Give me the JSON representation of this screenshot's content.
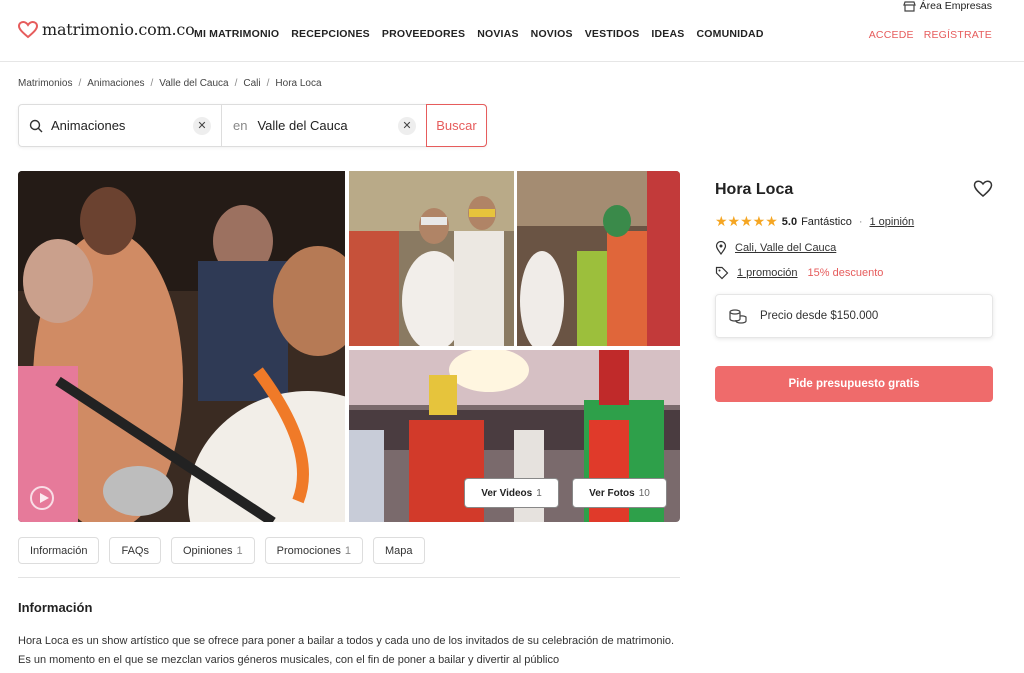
{
  "header": {
    "logo_text": "matrimonio.com.co",
    "nav": [
      "MI MATRIMONIO",
      "RECEPCIONES",
      "PROVEEDORES",
      "NOVIAS",
      "NOVIOS",
      "VESTIDOS",
      "IDEAS",
      "COMUNIDAD"
    ],
    "area_empresas": "Área Empresas",
    "accede": "ACCEDE",
    "registrate": "REGÍSTRATE"
  },
  "breadcrumb": [
    "Matrimonios",
    "Animaciones",
    "Valle del Cauca",
    "Cali",
    "Hora Loca"
  ],
  "search": {
    "what": "Animaciones",
    "en": "en",
    "where": "Valle del Cauca",
    "button": "Buscar"
  },
  "gallery": {
    "videos_label": "Ver Videos",
    "videos_count": "1",
    "photos_label": "Ver Fotos",
    "photos_count": "10"
  },
  "tabs": [
    {
      "label": "Información",
      "count": ""
    },
    {
      "label": "FAQs",
      "count": ""
    },
    {
      "label": "Opiniones",
      "count": "1"
    },
    {
      "label": "Promociones",
      "count": "1"
    },
    {
      "label": "Mapa",
      "count": ""
    }
  ],
  "info": {
    "title": "Información",
    "text": "Hora Loca es un show artístico que se ofrece para poner a bailar a todos y cada uno de los invitados de su celebración de matrimonio. Es un momento en el que se mezclan varios géneros musicales, con el fin de poner a bailar y divertir al público"
  },
  "vendor": {
    "name": "Hora Loca",
    "rating": "5.0",
    "rating_label": "Fantástico",
    "rating_stars": 5,
    "opinions": "1 opinión",
    "location": "Cali, Valle del Cauca",
    "promotion": "1 promoción",
    "discount": "15% descuento",
    "price": "Precio desde $150.000",
    "cta": "Pide presupuesto gratis"
  },
  "colors": {
    "accent": "#e65c5c",
    "cta": "#ef6b6b",
    "stars": "#f5a623"
  }
}
